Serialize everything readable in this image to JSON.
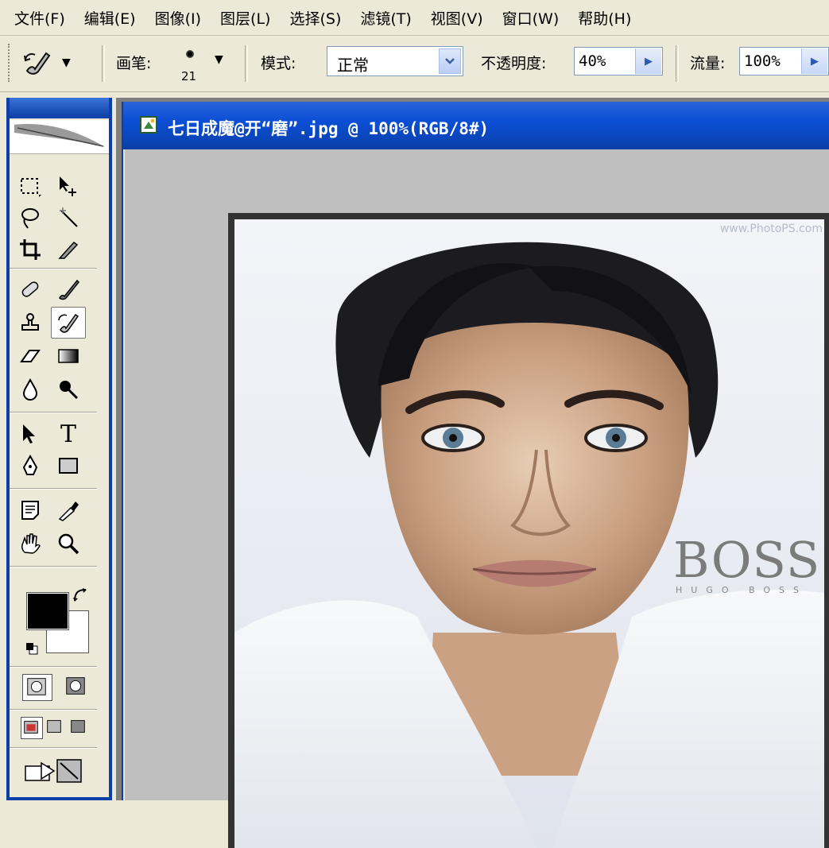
{
  "menu": [
    "文件(F)",
    "编辑(E)",
    "图像(I)",
    "图层(L)",
    "选择(S)",
    "滤镜(T)",
    "视图(V)",
    "窗口(W)",
    "帮助(H)"
  ],
  "options_bar": {
    "brush_label": "画笔:",
    "brush_size": "21",
    "mode_label": "模式:",
    "mode_value": "正常",
    "opacity_label": "不透明度:",
    "opacity_value": "40%",
    "flow_label": "流量:",
    "flow_value": "100%"
  },
  "document": {
    "title": "七日成魔@开“磨”.jpg @ 100%(RGB/8#)",
    "watermark": "www.PhotoPS.com",
    "logo_main": "BOSS",
    "logo_sub": "HUGO BOSS"
  },
  "toolbox": {
    "type_tool_glyph": "T",
    "foreground_color": "#000000",
    "background_color": "#ffffff"
  }
}
